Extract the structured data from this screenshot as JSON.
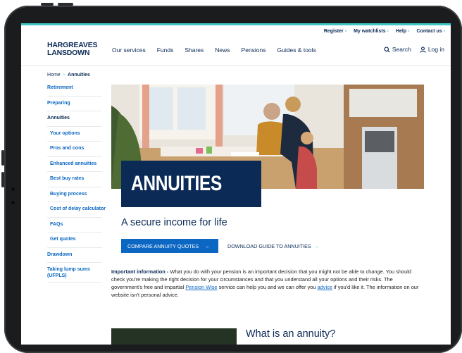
{
  "utility_nav": [
    {
      "label": "Register"
    },
    {
      "label": "My watchlists"
    },
    {
      "label": "Help"
    },
    {
      "label": "Contact us"
    }
  ],
  "logo": {
    "line1": "HARGREAVES",
    "line2": "LANSDOWN"
  },
  "main_nav": [
    "Our services",
    "Funds",
    "Shares",
    "News",
    "Pensions",
    "Guides & tools"
  ],
  "search_label": "Search",
  "login_label": "Log in",
  "breadcrumb": {
    "home": "Home",
    "current": "Annuities"
  },
  "sidebar": [
    {
      "label": "Retirement"
    },
    {
      "label": "Preparing"
    },
    {
      "label": "Annuities"
    },
    {
      "label": "Your options"
    },
    {
      "label": "Pros and cons"
    },
    {
      "label": "Enhanced annuities"
    },
    {
      "label": "Best buy rates"
    },
    {
      "label": "Buying process"
    },
    {
      "label": "Cost of delay calculator"
    },
    {
      "label": "FAQs"
    },
    {
      "label": "Get quotes"
    },
    {
      "label": "Drawdown"
    },
    {
      "label": "Taking lump sums (UFPLS)"
    }
  ],
  "hero_title": "ANNUITIES",
  "tagline": "A secure income for life",
  "cta_primary": "COMPARE ANNUITY QUOTES",
  "cta_secondary": "DOWNLOAD GUIDE TO ANNUITIES",
  "info": {
    "bold": "Important information -",
    "part1": " What you do with your pension is an important decision that you might not be able to change. You should check you're making the right decision for your circumstances and that you understand all your options and their risks. The government's free and impartial ",
    "link1": "Pension Wise",
    "part2": " service can help you and we can offer you ",
    "link2": "advice",
    "part3": " if you'd like it. The information on our website isn't personal advice."
  },
  "section_heading": "What is an annuity?",
  "colors": {
    "navy": "#0b2a56",
    "blue": "#0b67c2",
    "teal": "#3ec6c5"
  }
}
